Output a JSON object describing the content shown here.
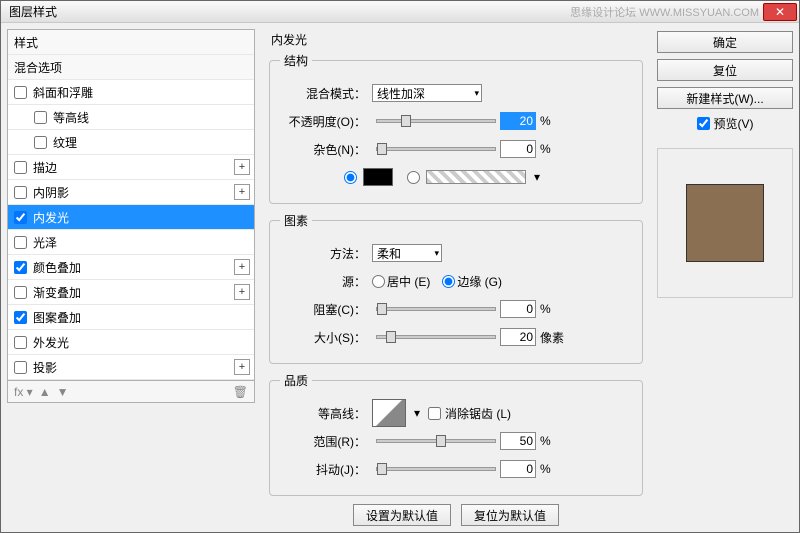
{
  "window": {
    "title": "图层样式",
    "watermark": "思缘设计论坛  WWW.MISSYUAN.COM"
  },
  "sidebar": {
    "header_styles": "样式",
    "header_blend": "混合选项",
    "items": [
      {
        "label": "斜面和浮雕",
        "checked": false,
        "indent": 0,
        "plus": false
      },
      {
        "label": "等高线",
        "checked": false,
        "indent": 1,
        "plus": false
      },
      {
        "label": "纹理",
        "checked": false,
        "indent": 1,
        "plus": false
      },
      {
        "label": "描边",
        "checked": false,
        "indent": 0,
        "plus": true
      },
      {
        "label": "内阴影",
        "checked": false,
        "indent": 0,
        "plus": true
      },
      {
        "label": "内发光",
        "checked": true,
        "indent": 0,
        "plus": false,
        "selected": true
      },
      {
        "label": "光泽",
        "checked": false,
        "indent": 0,
        "plus": false
      },
      {
        "label": "颜色叠加",
        "checked": true,
        "indent": 0,
        "plus": true
      },
      {
        "label": "渐变叠加",
        "checked": false,
        "indent": 0,
        "plus": true
      },
      {
        "label": "图案叠加",
        "checked": true,
        "indent": 0,
        "plus": false
      },
      {
        "label": "外发光",
        "checked": false,
        "indent": 0,
        "plus": false
      },
      {
        "label": "投影",
        "checked": false,
        "indent": 0,
        "plus": true
      }
    ]
  },
  "panel": {
    "title": "内发光",
    "structure": {
      "legend": "结构",
      "blend_mode_lbl": "混合模式：",
      "blend_mode_val": "线性加深",
      "opacity_lbl": "不透明度(O)：",
      "opacity_val": "20",
      "opacity_unit": "%",
      "noise_lbl": "杂色(N)：",
      "noise_val": "0",
      "noise_unit": "%"
    },
    "element": {
      "legend": "图素",
      "technique_lbl": "方法：",
      "technique_val": "柔和",
      "source_lbl": "源：",
      "source_center": "居中 (E)",
      "source_edge": "边缘 (G)",
      "choke_lbl": "阻塞(C)：",
      "choke_val": "0",
      "choke_unit": "%",
      "size_lbl": "大小(S)：",
      "size_val": "20",
      "size_unit": "像素"
    },
    "quality": {
      "legend": "品质",
      "contour_lbl": "等高线：",
      "antialias_lbl": "消除锯齿 (L)",
      "range_lbl": "范围(R)：",
      "range_val": "50",
      "range_unit": "%",
      "jitter_lbl": "抖动(J)：",
      "jitter_val": "0",
      "jitter_unit": "%"
    },
    "buttons": {
      "default": "设置为默认值",
      "reset": "复位为默认值"
    }
  },
  "right": {
    "ok": "确定",
    "cancel": "复位",
    "new_style": "新建样式(W)...",
    "preview": "预览(V)"
  }
}
